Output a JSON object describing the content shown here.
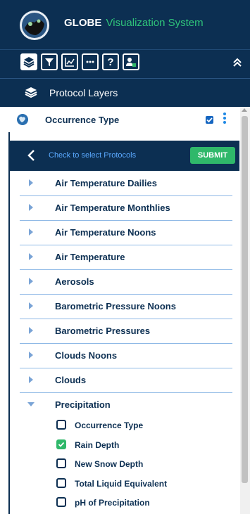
{
  "app": {
    "title_main": "GLOBE",
    "title_accent": "Visualization System"
  },
  "toolbar": {
    "buttons": [
      "layers-icon",
      "filter-icon",
      "chart-icon",
      "more-icon",
      "help-icon",
      "user-lock-icon"
    ],
    "collapse": "double-chevron-up-icon"
  },
  "layers_panel": {
    "title": "Protocol Layers"
  },
  "occurrence": {
    "title": "Occurrence Type",
    "checked": true
  },
  "select_bar": {
    "hint": "Check to select Protocols",
    "submit_label": "SUBMIT"
  },
  "protocols": [
    "Air Temperature Dailies",
    "Air Temperature Monthlies",
    "Air Temperature Noons",
    "Air Temperature",
    "Aerosols",
    "Barometric Pressure Noons",
    "Barometric Pressures",
    "Clouds Noons",
    "Clouds",
    "Precipitation"
  ],
  "precipitation_items": [
    {
      "label": "Occurrence Type",
      "checked": false
    },
    {
      "label": "Rain Depth",
      "checked": true
    },
    {
      "label": "New Snow Depth",
      "checked": false
    },
    {
      "label": "Total Liquid Equivalent",
      "checked": false
    },
    {
      "label": "pH of Precipitation",
      "checked": false
    }
  ],
  "colors": {
    "navy": "#0c2f52",
    "green": "#2fb86a",
    "blue": "#1e88e5"
  }
}
